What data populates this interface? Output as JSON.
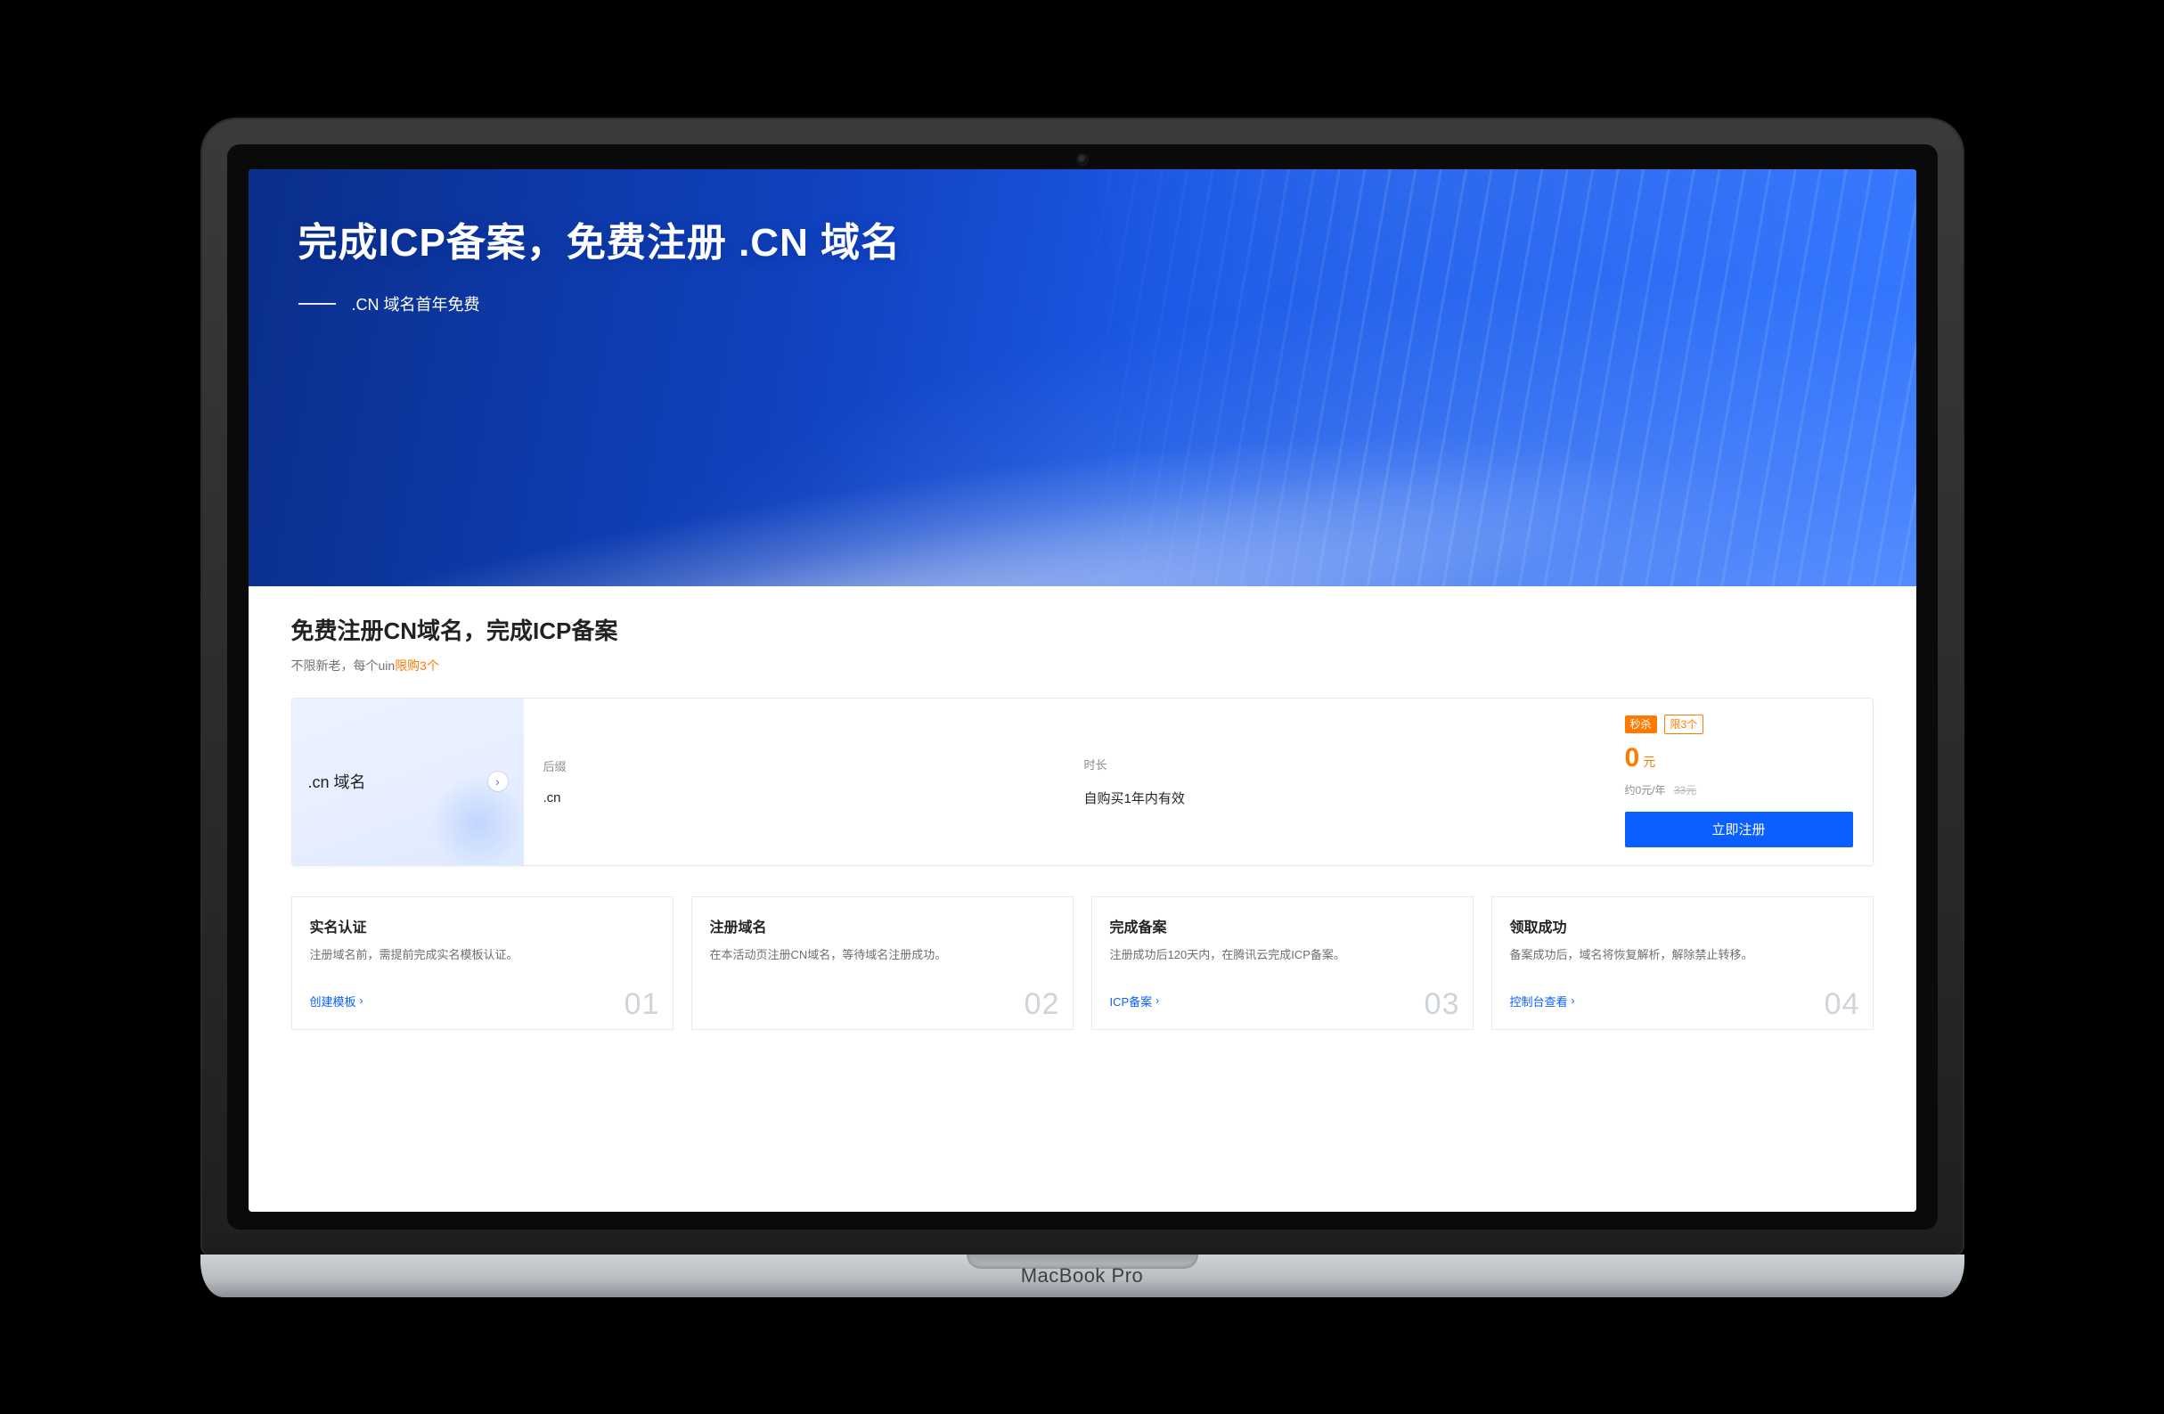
{
  "device": {
    "label": "MacBook Pro"
  },
  "hero": {
    "title": "完成ICP备案，免费注册 .CN 域名",
    "subtitle": ".CN 域名首年免费"
  },
  "section": {
    "title": "免费注册CN域名，完成ICP备案",
    "sub_prefix": "不限新老，每个uin",
    "sub_highlight": "限购3个"
  },
  "product": {
    "name": ".cn 域名",
    "cols": [
      {
        "label": "后缀",
        "value": ".cn"
      },
      {
        "label": "时长",
        "value": "自购买1年内有效"
      }
    ],
    "tag_solid": "秒杀",
    "tag_ghost": "限3个",
    "price_value": "0",
    "price_unit": "元",
    "price_sub": "约0元/年",
    "price_strike": "33元",
    "cta": "立即注册"
  },
  "steps": [
    {
      "num": "01",
      "title": "实名认证",
      "desc": "注册域名前，需提前完成实名模板认证。",
      "link": "创建模板"
    },
    {
      "num": "02",
      "title": "注册域名",
      "desc": "在本活动页注册CN域名，等待域名注册成功。",
      "link": ""
    },
    {
      "num": "03",
      "title": "完成备案",
      "desc": "注册成功后120天内，在腾讯云完成ICP备案。",
      "link": "ICP备案"
    },
    {
      "num": "04",
      "title": "领取成功",
      "desc": "备案成功后，域名将恢复解析，解除禁止转移。",
      "link": "控制台查看"
    }
  ]
}
